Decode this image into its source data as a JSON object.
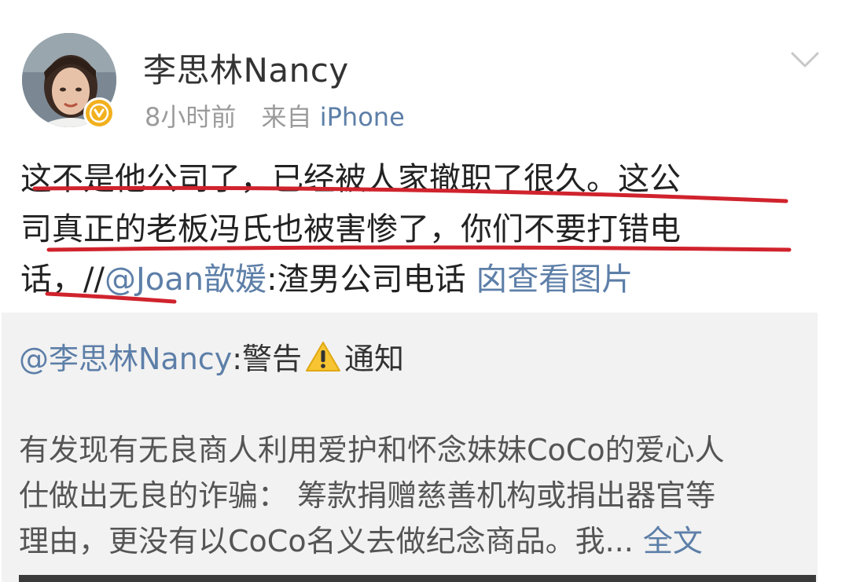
{
  "post": {
    "author": "李思林Nancy",
    "time": "8小时前",
    "source_prefix": "来自",
    "source_device": "iPhone",
    "lines": [
      "这不是他公司了，已经被人家撤职了很久。这公",
      "司真正的老板冯氏也被害惨了，你们不要打错电"
    ],
    "line3_prefix": "话，//",
    "line3_mention": "@Joan歆媛",
    "line3_rest": ":渣男公司电话",
    "view_image": "囟查看图片"
  },
  "retweet": {
    "mention": "@李思林Nancy",
    "head_text_1": ":警告",
    "head_text_2": "通知",
    "lines": [
      "有发现有无良商人利用爱护和怀念妹妹CoCo的爱心人",
      "仕做出无良的诈骗：  筹款捐赠慈善机构或捐出器官等",
      "理由，更没有以CoCo名义去做纪念商品。我... "
    ],
    "full_text_link": "全文"
  },
  "icons": {
    "verified": "verified-badge-icon",
    "chevron": "chevron-down-icon",
    "warning": "warning-icon"
  },
  "colors": {
    "link": "#5d7fa8",
    "annotation_red": "#d0232d",
    "verified_gold": "#f2b01e",
    "card_bg": "#f2f2f2"
  }
}
